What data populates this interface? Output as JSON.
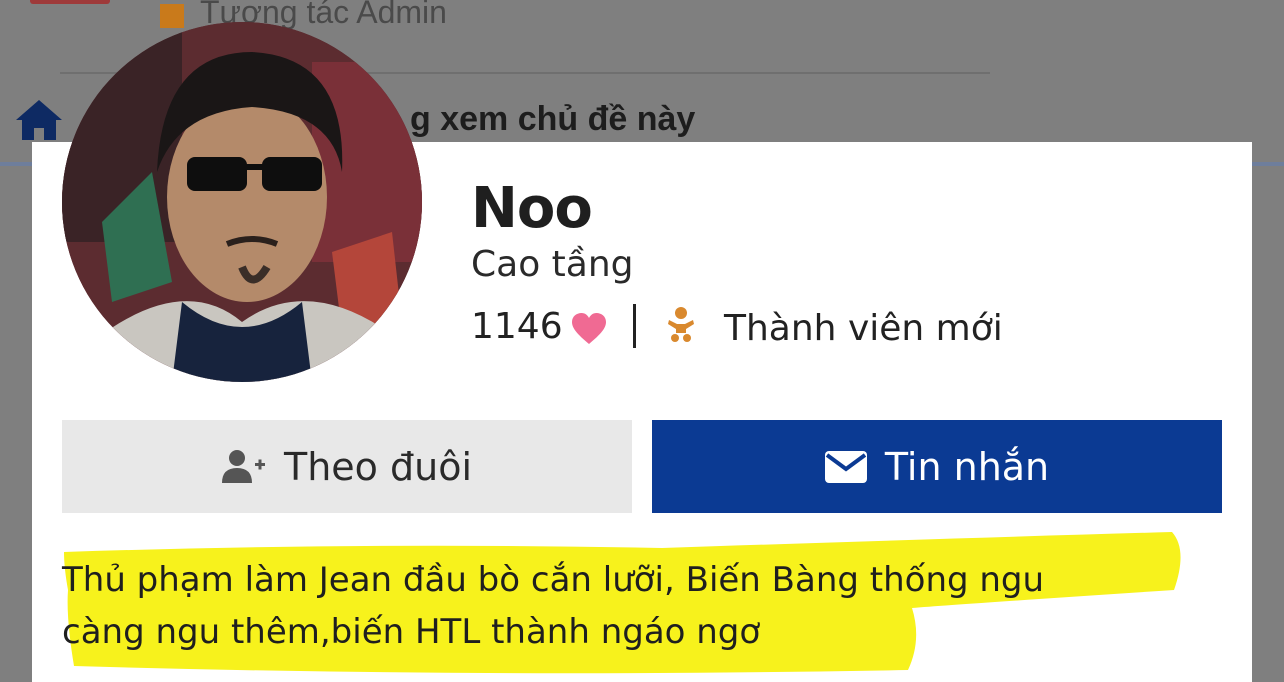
{
  "background": {
    "menu_item": "Tương tác Admin",
    "heading": "g xem chủ đề này"
  },
  "profile": {
    "name": "Noo",
    "title": "Cao tầng",
    "reaction_count": "1146",
    "member_rank": "Thành viên mới",
    "follow_label": "Theo đuôi",
    "message_label": "Tin nhắn",
    "about_line1": "Thủ phạm làm Jean đầu bò cắn lưỡi, Biến Bàng thống ngu",
    "about_line2": "càng ngu thêm,biến HTL thành ngáo ngơ"
  },
  "icons": {
    "home": "home-icon",
    "reaction": "heart-icon",
    "rank": "baby-icon",
    "follow": "user-plus-icon",
    "message": "envelope-icon"
  },
  "colors": {
    "overlay": "#7f7f7f",
    "brand_blue": "#0b3a93",
    "heart": "#f06a93",
    "rank_icon": "#d9892e",
    "highlight": "#f7f21c",
    "follow_bg": "#e8e8e8"
  }
}
